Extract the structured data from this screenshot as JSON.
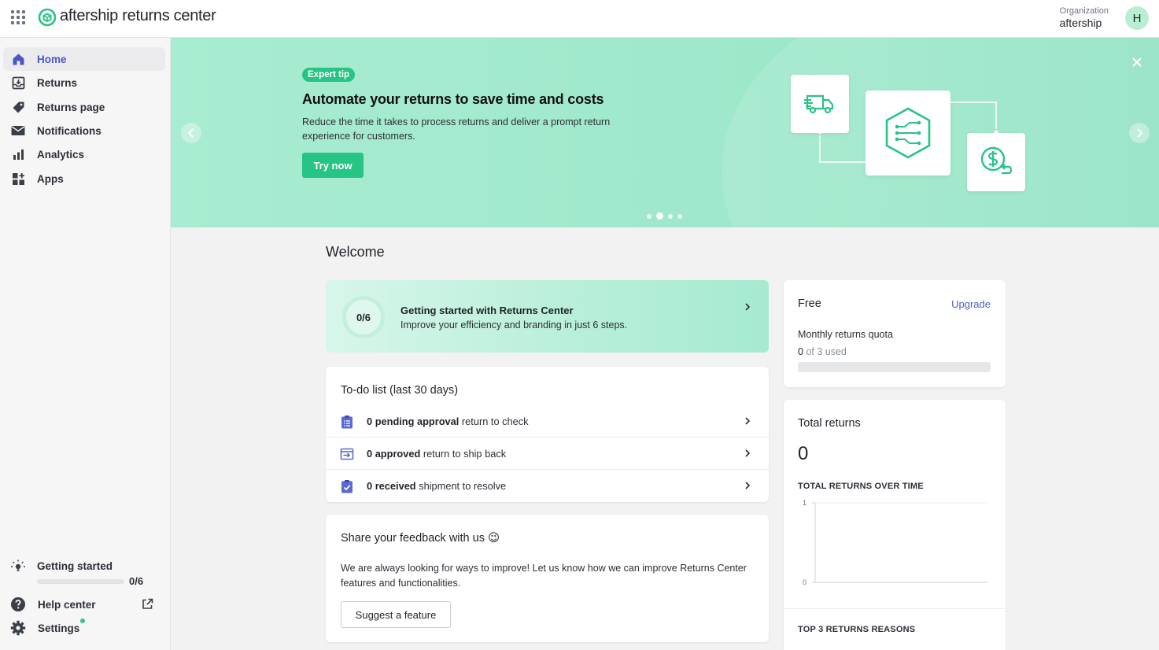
{
  "app": {
    "brand": "aftership returns center"
  },
  "org": {
    "label": "Organization",
    "name": "aftership",
    "avatar_initial": "H"
  },
  "sidebar": {
    "items": [
      {
        "label": "Home",
        "icon": "home-icon",
        "active": true
      },
      {
        "label": "Returns",
        "icon": "inbox-return-icon"
      },
      {
        "label": "Returns page",
        "icon": "tag-icon"
      },
      {
        "label": "Notifications",
        "icon": "envelope-icon"
      },
      {
        "label": "Analytics",
        "icon": "bar-chart-icon"
      },
      {
        "label": "Apps",
        "icon": "apps-plus-icon"
      }
    ],
    "getting_started": {
      "label": "Getting started",
      "count": "0/6",
      "progress": 0
    },
    "help": {
      "label": "Help center"
    },
    "settings": {
      "label": "Settings"
    }
  },
  "banner": {
    "badge": "Expert tip",
    "title": "Automate your returns to save time and costs",
    "description": "Reduce the time it takes to process returns and deliver a prompt return experience for customers.",
    "cta": "Try now",
    "slides": 4,
    "active_slide": 2
  },
  "welcome": "Welcome",
  "getting_started_card": {
    "progress": "0/6",
    "title": "Getting started with Returns Center",
    "subtitle": "Improve your efficiency and branding in just 6 steps."
  },
  "todo": {
    "title": "To-do list (last 30 days)",
    "rows": [
      {
        "count": "0",
        "bold": "pending approval",
        "rest": "return to check",
        "icon": "clipboard-list-icon"
      },
      {
        "count": "0",
        "bold": "approved",
        "rest": "return to ship back",
        "icon": "ship-back-icon"
      },
      {
        "count": "0",
        "bold": "received",
        "rest": "shipment to resolve",
        "icon": "clipboard-check-icon"
      }
    ]
  },
  "feedback": {
    "title": "Share your feedback with us",
    "emoji": "😉",
    "text": "We are always looking for ways to improve! Let us know how we can improve Returns Center features and functionalities.",
    "button": "Suggest a feature"
  },
  "plan": {
    "name": "Free",
    "upgrade": "Upgrade",
    "quota_label": "Monthly returns quota",
    "used": "0",
    "used_suffix": "of 3 used",
    "used_fraction": 0
  },
  "totals": {
    "title": "Total returns",
    "value": "0",
    "chart_title": "TOTAL RETURNS OVER TIME",
    "reasons_title": "TOP 3 RETURNS REASONS"
  },
  "chart_data": {
    "type": "line",
    "title": "TOTAL RETURNS OVER TIME",
    "x": [],
    "series": [],
    "yticks": [
      "1",
      "0"
    ],
    "ylim": [
      0,
      1
    ],
    "grid": true
  },
  "colors": {
    "accent": "#26c485",
    "banner_bg": "#a8ecd1",
    "nav_active": "#4b57c5",
    "link": "#4b63c5"
  }
}
